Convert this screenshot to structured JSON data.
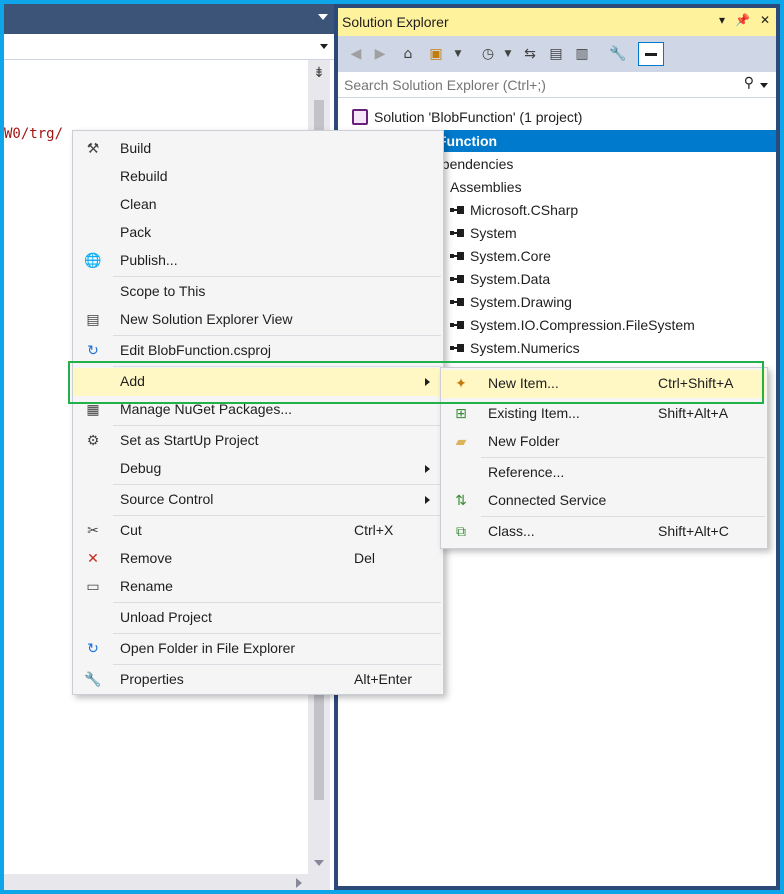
{
  "editor": {
    "code_fragment": "W0/trg/",
    "split_icon": "splitter-icon"
  },
  "solution_explorer": {
    "title": "Solution Explorer",
    "title_icons": [
      "dropdown-icon",
      "pin-icon",
      "close-icon"
    ],
    "toolbar_icons": [
      "back-icon",
      "forward-icon",
      "home-icon",
      "switch-views-icon",
      "pending-changes-icon",
      "sync-icon",
      "collapse-all-icon",
      "show-all-files-icon",
      "properties-icon",
      "preview-icon"
    ],
    "search": {
      "placeholder": "Search Solution Explorer (Ctrl+;)"
    },
    "tree": {
      "solution": "Solution 'BlobFunction' (1 project)",
      "project": "Function",
      "dependencies": "ependencies",
      "assemblies": "Assemblies",
      "references": [
        "Microsoft.CSharp",
        "System",
        "System.Core",
        "System.Data",
        "System.Drawing",
        "System.IO.Compression.FileSystem",
        "System.Numerics"
      ]
    }
  },
  "context_menu": {
    "items": [
      {
        "label": "Build",
        "icon": "build-icon"
      },
      {
        "label": "Rebuild"
      },
      {
        "label": "Clean"
      },
      {
        "label": "Pack"
      },
      {
        "label": "Publish...",
        "icon": "publish-globe-icon"
      },
      {
        "label": "Scope to This"
      },
      {
        "label": "New Solution Explorer View",
        "icon": "new-view-icon"
      },
      {
        "label": "Edit BlobFunction.csproj",
        "icon": "edit-refresh-icon"
      },
      {
        "label": "Add"
      },
      {
        "label": "Manage NuGet Packages...",
        "icon": "nuget-icon"
      },
      {
        "label": "Set as StartUp Project",
        "icon": "gear-icon"
      },
      {
        "label": "Debug"
      },
      {
        "label": "Source Control"
      },
      {
        "label": "Cut",
        "shortcut": "Ctrl+X",
        "icon": "scissors-icon"
      },
      {
        "label": "Remove",
        "shortcut": "Del",
        "icon": "remove-x-icon"
      },
      {
        "label": "Rename",
        "icon": "rename-icon"
      },
      {
        "label": "Unload Project"
      },
      {
        "label": "Open Folder in File Explorer",
        "icon": "open-folder-icon"
      },
      {
        "label": "Properties",
        "shortcut": "Alt+Enter",
        "icon": "wrench-icon"
      }
    ]
  },
  "add_submenu": {
    "items": [
      {
        "label": "New Item...",
        "shortcut": "Ctrl+Shift+A",
        "icon": "new-item-icon"
      },
      {
        "label": "Existing Item...",
        "shortcut": "Shift+Alt+A",
        "icon": "existing-item-icon"
      },
      {
        "label": "New Folder",
        "icon": "new-folder-icon"
      },
      {
        "label": "Reference..."
      },
      {
        "label": "Connected Service",
        "icon": "connected-service-icon"
      },
      {
        "label": "Class...",
        "shortcut": "Shift+Alt+C",
        "icon": "class-icon"
      }
    ]
  },
  "colors": {
    "selection": "#007acc",
    "menu_highlight": "#fff8c5",
    "title_active": "#fff29d",
    "annotation_box": "#22b04b"
  }
}
